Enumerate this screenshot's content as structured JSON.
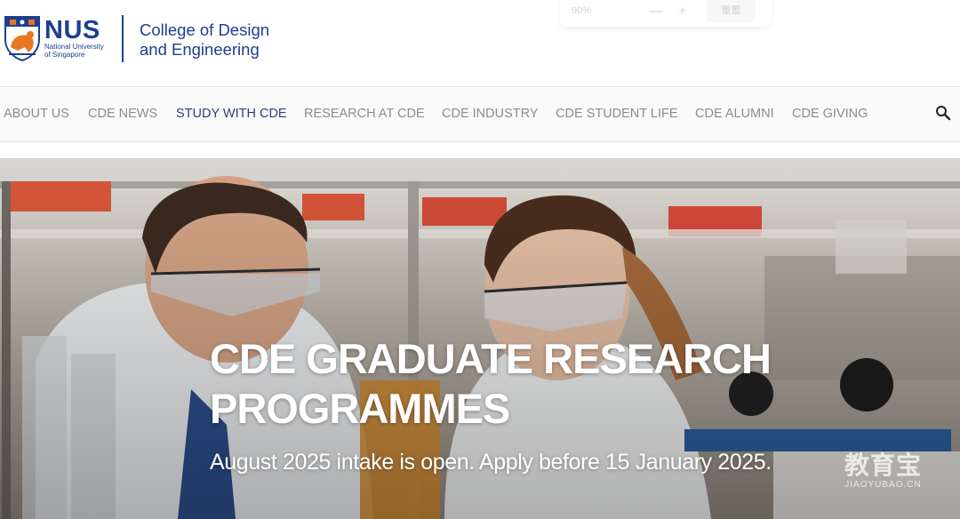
{
  "header": {
    "logo": {
      "wordmark": "NUS",
      "sub_line1": "National University",
      "sub_line2": "of Singapore"
    },
    "college_line1": "College of Design",
    "college_line2": "and Engineering",
    "brand_color": "#1d3f8f"
  },
  "zoom_widget": {
    "level": "90%",
    "minus": "—",
    "plus": "+",
    "reset": "重置"
  },
  "nav": {
    "items": [
      {
        "label": "ABOUT US",
        "active": false
      },
      {
        "label": "CDE NEWS",
        "active": false
      },
      {
        "label": "STUDY WITH CDE",
        "active": true
      },
      {
        "label": "RESEARCH AT CDE",
        "active": false
      },
      {
        "label": "CDE INDUSTRY",
        "active": false
      },
      {
        "label": "CDE STUDENT LIFE",
        "active": false
      },
      {
        "label": "CDE ALUMNI",
        "active": false
      },
      {
        "label": "CDE GIVING",
        "active": false
      }
    ],
    "search_icon": "search-icon",
    "active_color": "#2a3f7d"
  },
  "hero": {
    "title": "CDE GRADUATE RESEARCH PROGRAMMES",
    "subtitle": "August 2025 intake is open. Apply before 15 January 2025.",
    "image": "lab-researchers-photo"
  },
  "watermark": {
    "text_cn": "教育宝",
    "text_en": "JIAOYUBAO.CN"
  }
}
